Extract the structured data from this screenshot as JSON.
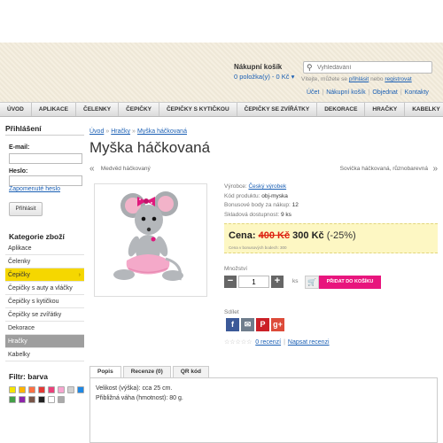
{
  "header": {
    "cart_title": "Nákupní košík",
    "cart_summary": "0 položka(y) - 0 Kč",
    "cart_summary_arrow": "▾",
    "search_placeholder": "Vyhledávání",
    "welcome_prefix": "Vítejte, můžete se",
    "welcome_login": "přihlásit",
    "welcome_middle": "nebo",
    "welcome_register": "registrovat",
    "toplinks": [
      "Účet",
      "Nákupní košík",
      "Objednat",
      "Kontakty"
    ]
  },
  "nav": {
    "items": [
      "ÚVOD",
      "APLIKACE",
      "ČELENKY",
      "ČEPIČKY",
      "ČEPIČKY S KYTIČKOU",
      "ČEPIČKY SE ZVÍŘÁTKY",
      "DEKORACE",
      "HRAČKY",
      "KABELKY"
    ]
  },
  "sidebar": {
    "login_heading": "Přihlášení",
    "email_label": "E-mail:",
    "password_label": "Heslo:",
    "forgot_link": "Zapomenuté heslo",
    "login_button": "Přihlásit",
    "categories_heading": "Kategorie zboží",
    "categories": [
      "Aplikace",
      "Čelenky",
      "Čepičky",
      "Čepičky s auty a vláčky",
      "Čepičky s kytičkou",
      "Čepičky se zvířátky",
      "Dekorace",
      "Hračky",
      "Kabelky"
    ],
    "category_arrow": "›",
    "filter_heading": "Filtr: barva",
    "swatch_colors": [
      "#f5e400",
      "#ffb300",
      "#ff7043",
      "#e53935",
      "#ec407a",
      "#f8a5d0",
      "#d0d0d0",
      "#1e88e5",
      "#43a047",
      "#8e24aa",
      "#795548",
      "#222222",
      "#ffffff",
      "#aaaaaa"
    ]
  },
  "product": {
    "breadcrumb": [
      "Úvod",
      "Hračky",
      "Myška háčkovaná"
    ],
    "breadcrumb_sep": "»",
    "title": "Myška háčkovaná",
    "prev_arrow": "«",
    "prev_label": "Medvěd háčkovaný",
    "next_label": "Sovička háčkovaná, různobarevná",
    "next_arrow": "»",
    "specs": [
      {
        "label": "Výrobce:",
        "value": "Český výrobek"
      },
      {
        "label": "Kód produktu:",
        "value": "obj-myska"
      },
      {
        "label": "Bonusové body za nákup:",
        "value": "12"
      },
      {
        "label": "Skladová dostupnost:",
        "value": "9 ks"
      }
    ],
    "price_label": "Cena:",
    "old_price": "400 Kč",
    "new_price": "300 Kč",
    "discount": "(-25%)",
    "price_note": "Cena v bonusových bodech: 300",
    "qty_label": "Množství",
    "qty_value": "1",
    "qty_minus": "−",
    "qty_plus": "+",
    "qty_unit": "ks",
    "add_to_cart": "PŘIDAT DO KOŠÍKU",
    "share_label": "Sdílet",
    "social": [
      "f",
      "✉",
      "P",
      "g+"
    ],
    "social_colors": [
      "#3b5998",
      "#6f7d8c",
      "#cb2027",
      "#dd4b39"
    ],
    "stars": "☆☆☆☆☆",
    "reviews_link": "0 recenzí",
    "write_review": "Napsat recenzi"
  },
  "tabs": {
    "labels": [
      "Popis",
      "Recenze (0)",
      "QR kód"
    ],
    "description": [
      "Velikost (výška): cca 25 cm.",
      "Přibližná váha (hmotnost): 80 g."
    ]
  }
}
